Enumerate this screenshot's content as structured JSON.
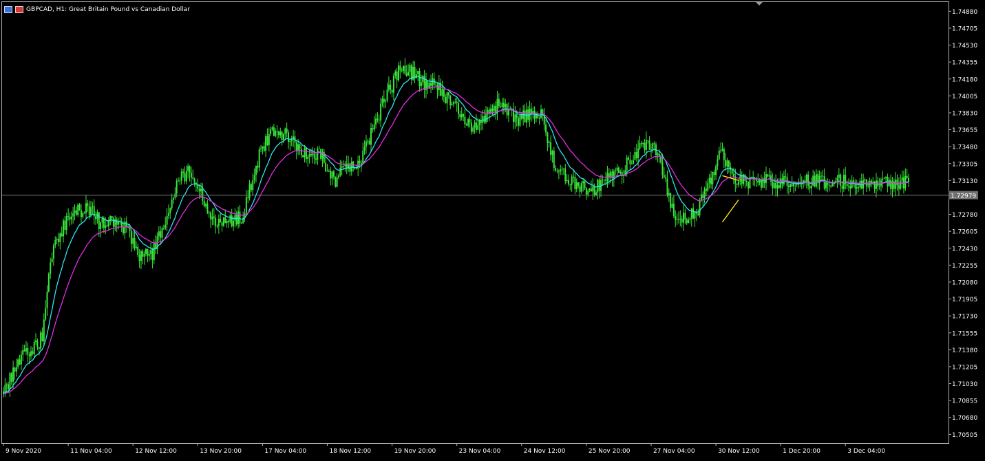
{
  "window": {
    "symbol_title": "GBPCAD, H1:  Great Britain Pound vs Canadian Dollar"
  },
  "colors": {
    "background": "#000000",
    "frame": "#b4b4b4",
    "candles": "#39e639",
    "fast_ma": "#2ee6ee",
    "slow_ma": "#e22ee2",
    "trend_lines": "#ffd820",
    "bid_line": "#808080",
    "price_label_bg": "#707070",
    "text": "#ffffff"
  },
  "chart_data": {
    "type": "candlestick",
    "symbol": "GBPCAD",
    "timeframe": "H1",
    "y_axis": {
      "ylim": [
        1.70415,
        1.74975
      ],
      "ticks": [
        "1.74880",
        "1.74705",
        "1.74530",
        "1.74355",
        "1.74180",
        "1.74005",
        "1.73830",
        "1.73655",
        "1.73480",
        "1.73305",
        "1.73130",
        "1.72955",
        "1.72780",
        "1.72605",
        "1.72430",
        "1.72255",
        "1.72080",
        "1.71905",
        "1.71730",
        "1.71555",
        "1.71380",
        "1.71205",
        "1.71030",
        "1.70855",
        "1.70680",
        "1.70505"
      ]
    },
    "x_axis": {
      "labels": [
        "9 Nov 2020",
        "11 Nov 04:00",
        "12 Nov 12:00",
        "13 Nov 20:00",
        "17 Nov 04:00",
        "18 Nov 12:00",
        "19 Nov 20:00",
        "23 Nov 04:00",
        "24 Nov 12:00",
        "25 Nov 20:00",
        "27 Nov 04:00",
        "30 Nov 12:00",
        "1 Dec 20:00",
        "3 Dec 04:00"
      ]
    },
    "current_price": "1.72979",
    "close_path": [
      {
        "t": "9 Nov 2020",
        "v": 1.7095
      },
      {
        "t": "9 Nov 2020 12:00",
        "v": 1.713
      },
      {
        "t": "10 Nov 2020 00:00",
        "v": 1.715
      },
      {
        "t": "10 Nov 2020 06:00",
        "v": 1.724
      },
      {
        "t": "10 Nov 2020 16:00",
        "v": 1.7275
      },
      {
        "t": "11 Nov 04:00",
        "v": 1.7285
      },
      {
        "t": "11 Nov 12:00",
        "v": 1.7268
      },
      {
        "t": "11 Nov 20:00",
        "v": 1.727
      },
      {
        "t": "12 Nov 04:00",
        "v": 1.7262
      },
      {
        "t": "12 Nov 12:00",
        "v": 1.7235
      },
      {
        "t": "12 Nov 20:00",
        "v": 1.7238
      },
      {
        "t": "13 Nov 04:00",
        "v": 1.7275
      },
      {
        "t": "13 Nov 12:00",
        "v": 1.7315
      },
      {
        "t": "13 Nov 20:00",
        "v": 1.7322
      },
      {
        "t": "16 Nov 04:00",
        "v": 1.729
      },
      {
        "t": "16 Nov 12:00",
        "v": 1.727
      },
      {
        "t": "16 Nov 20:00",
        "v": 1.7272
      },
      {
        "t": "17 Nov 04:00",
        "v": 1.7276
      },
      {
        "t": "17 Nov 12:00",
        "v": 1.733
      },
      {
        "t": "17 Nov 20:00",
        "v": 1.736
      },
      {
        "t": "18 Nov 04:00",
        "v": 1.7362
      },
      {
        "t": "18 Nov 12:00",
        "v": 1.7352
      },
      {
        "t": "18 Nov 20:00",
        "v": 1.7335
      },
      {
        "t": "19 Nov 04:00",
        "v": 1.734
      },
      {
        "t": "19 Nov 12:00",
        "v": 1.7312
      },
      {
        "t": "19 Nov 20:00",
        "v": 1.733
      },
      {
        "t": "20 Nov 04:00",
        "v": 1.7328
      },
      {
        "t": "20 Nov 12:00",
        "v": 1.7368
      },
      {
        "t": "20 Nov 20:00",
        "v": 1.7398
      },
      {
        "t": "23 Nov 04:00",
        "v": 1.7425
      },
      {
        "t": "23 Nov 12:00",
        "v": 1.7425
      },
      {
        "t": "23 Nov 20:00",
        "v": 1.7412
      },
      {
        "t": "24 Nov 04:00",
        "v": 1.741
      },
      {
        "t": "24 Nov 12:00",
        "v": 1.7395
      },
      {
        "t": "24 Nov 20:00",
        "v": 1.7375
      },
      {
        "t": "25 Nov 04:00",
        "v": 1.7365
      },
      {
        "t": "25 Nov 12:00",
        "v": 1.7385
      },
      {
        "t": "25 Nov 20:00",
        "v": 1.7395
      },
      {
        "t": "26 Nov 04:00",
        "v": 1.7375
      },
      {
        "t": "26 Nov 12:00",
        "v": 1.738
      },
      {
        "t": "26 Nov 20:00",
        "v": 1.7385
      },
      {
        "t": "27 Nov 04:00",
        "v": 1.733
      },
      {
        "t": "27 Nov 12:00",
        "v": 1.7318
      },
      {
        "t": "27 Nov 20:00",
        "v": 1.7305
      },
      {
        "t": "30 Nov 04:00",
        "v": 1.7305
      },
      {
        "t": "30 Nov 12:00",
        "v": 1.7315
      },
      {
        "t": "30 Nov 20:00",
        "v": 1.732
      },
      {
        "t": "1 Dec 04:00",
        "v": 1.7335
      },
      {
        "t": "1 Dec 12:00",
        "v": 1.735
      },
      {
        "t": "1 Dec 20:00",
        "v": 1.7345
      },
      {
        "t": "2 Dec 04:00",
        "v": 1.7285
      },
      {
        "t": "2 Dec 12:00",
        "v": 1.7272
      },
      {
        "t": "2 Dec 20:00",
        "v": 1.728
      },
      {
        "t": "3 Dec 04:00",
        "v": 1.731
      },
      {
        "t": "3 Dec 12:00",
        "v": 1.7345
      },
      {
        "t": "3 Dec 16:00",
        "v": 1.732
      },
      {
        "t": "3 Dec 22:00",
        "v": 1.7312
      }
    ],
    "trend_lines": [
      {
        "from": {
          "t": "3 Dec 12:00",
          "v": 1.7318
        },
        "to": {
          "t": "3 Dec 22:00",
          "v": 1.7313
        }
      },
      {
        "from": {
          "t": "3 Dec 12:00",
          "v": 1.727
        },
        "to": {
          "t": "3 Dec 22:00",
          "v": 1.7293
        }
      }
    ]
  }
}
